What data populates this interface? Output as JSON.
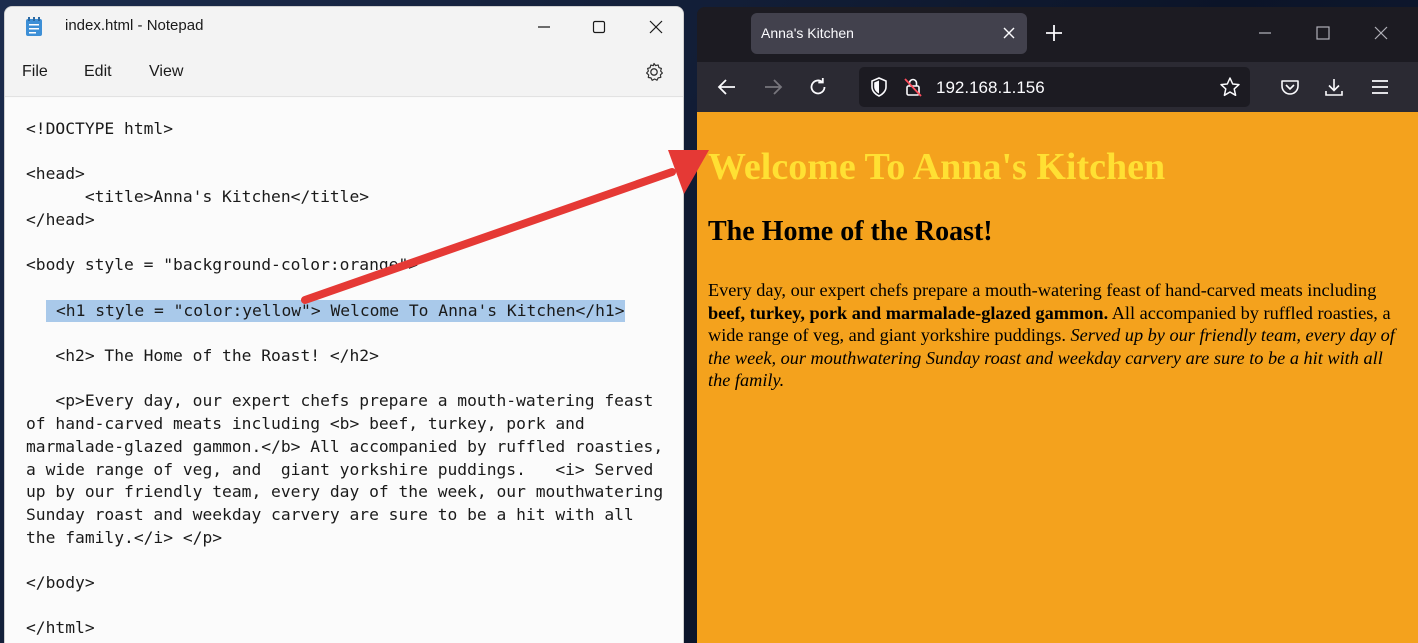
{
  "notepad": {
    "title": "index.html - Notepad",
    "menu": {
      "file": "File",
      "edit": "Edit",
      "view": "View"
    },
    "code_lines": [
      "<!DOCTYPE html>",
      "",
      "<head>",
      "      <title>Anna's Kitchen</title>",
      "</head>",
      "",
      "<body style = \"background-color:orange\">",
      "",
      "  <h1 style = \"color:yellow\"> Welcome To Anna's Kitchen</h1>",
      "",
      "   <h2> The Home of the Roast! </h2>",
      "",
      "   <p>Every day, our expert chefs prepare a mouth-watering feast",
      "of hand-carved meats including <b> beef, turkey, pork and",
      "marmalade-glazed gammon.</b> All accompanied by ruffled roasties,",
      "a wide range of veg, and  giant yorkshire puddings.   <i> Served",
      "up by our friendly team, every day of the week, our mouthwatering",
      "Sunday roast and weekday carvery are sure to be a hit with all",
      "the family.</i> </p>",
      "",
      "</body>",
      "",
      "</html>"
    ],
    "selected_line_index": 8
  },
  "browser": {
    "tab_title": "Anna's Kitchen",
    "url": "192.168.1.156",
    "page": {
      "background_color": "#f4a21d",
      "h1": "Welcome To Anna's Kitchen",
      "h1_color": "#ffe033",
      "h2": "The Home of the Roast!",
      "p_intro": "Every day, our expert chefs prepare a mouth-watering feast of hand-carved meats including ",
      "p_bold": "beef, turkey, pork and marmalade-glazed gammon.",
      "p_middle": " All accompanied by ruffled roasties, a wide range of veg, and giant yorkshire puddings. ",
      "p_italic": "Served up by our friendly team, every day of the week, our mouthwatering Sunday roast and weekday carvery are sure to be a hit with all the family."
    }
  },
  "annotation": {
    "arrow_color": "#e53935"
  }
}
